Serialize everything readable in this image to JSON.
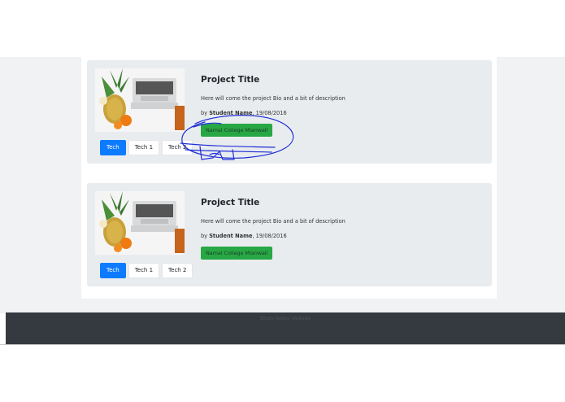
{
  "cards": [
    {
      "title": "Project Title",
      "description": "Here will come the project Bio and a bit of description",
      "by_prefix": "by ",
      "student_name": "Student Name",
      "date": ", 19/08/2016",
      "college_button": "Namal College Mianwali",
      "tech_tags": [
        "Tech",
        "Tech 1",
        "Tech 2"
      ],
      "image_icon": "laptop-pineapple-photo"
    },
    {
      "title": "Project Title",
      "description": "Here will come the project Bio and a bit of description",
      "by_prefix": "by ",
      "student_name": "Student Name",
      "date": ", 19/08/2016",
      "college_button": "Namal College Mianwali",
      "tech_tags": [
        "Tech",
        "Tech 1",
        "Tech 2"
      ],
      "image_icon": "laptop-pineapple-photo"
    }
  ],
  "footer": {
    "text": "Study Notes Website"
  },
  "colors": {
    "primary": "#0d7bff",
    "success": "#28a745",
    "card_bg": "#e9ecef",
    "footer_bg": "#343a40",
    "annotation_ink": "#1f2ed6"
  }
}
